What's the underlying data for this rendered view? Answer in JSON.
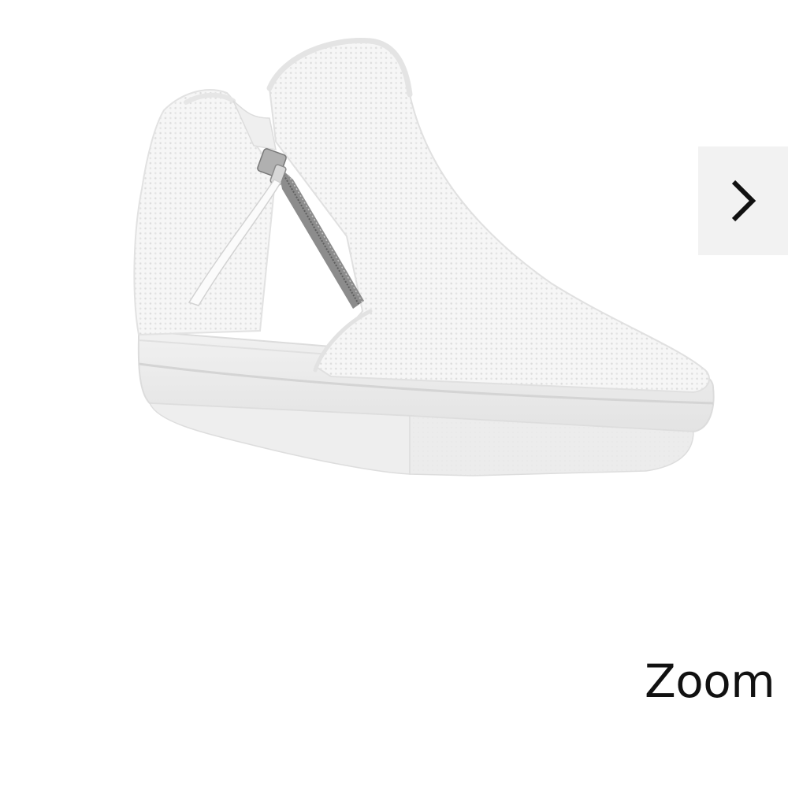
{
  "viewer": {
    "zoom_label": "Zoom",
    "next_button_icon": "chevron-right-icon",
    "product_image_icon": "white-knit-zip-wedge-sneaker-image"
  },
  "colors": {
    "background": "#ffffff",
    "arrow_button_bg": "#f2f2f2",
    "arrow_glyph": "#111111",
    "zoom_text": "#111111",
    "shoe_upper": "#f5f5f5",
    "shoe_sole": "#ececec",
    "zipper_metal": "#9a9a9a"
  }
}
